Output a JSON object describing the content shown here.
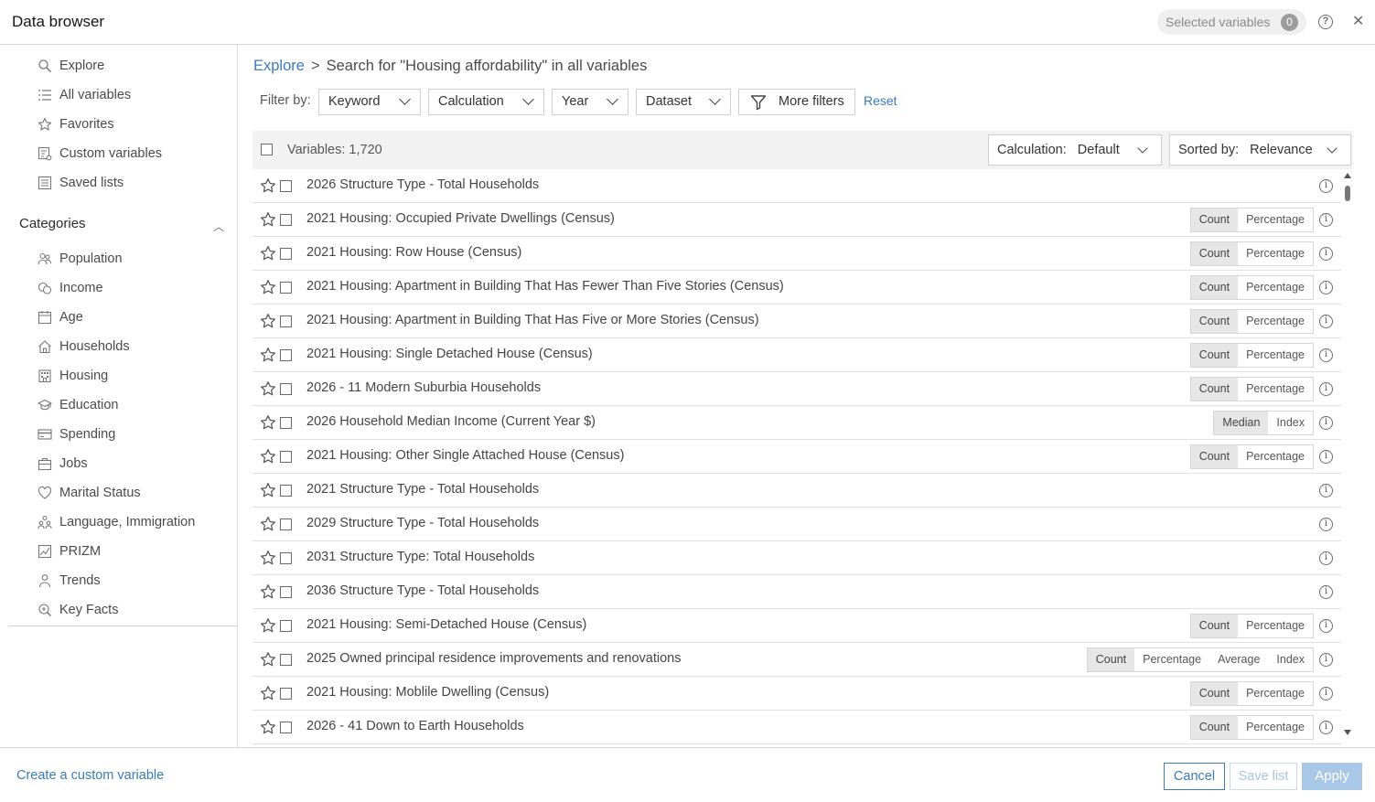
{
  "window": {
    "title": "Data browser",
    "selected_label": "Selected variables",
    "selected_count": "0"
  },
  "sidebar": {
    "nav": [
      {
        "label": "Explore",
        "icon": "search-icon"
      },
      {
        "label": "All variables",
        "icon": "list-icon"
      },
      {
        "label": "Favorites",
        "icon": "star-icon"
      },
      {
        "label": "Custom variables",
        "icon": "custom-variables-icon"
      },
      {
        "label": "Saved lists",
        "icon": "saved-lists-icon"
      }
    ],
    "categories_title": "Categories",
    "categories": [
      {
        "label": "Population",
        "icon": "population-icon"
      },
      {
        "label": "Income",
        "icon": "income-icon"
      },
      {
        "label": "Age",
        "icon": "calendar-icon"
      },
      {
        "label": "Households",
        "icon": "households-icon"
      },
      {
        "label": "Housing",
        "icon": "building-icon"
      },
      {
        "label": "Education",
        "icon": "education-icon"
      },
      {
        "label": "Spending",
        "icon": "credit-card-icon"
      },
      {
        "label": "Jobs",
        "icon": "briefcase-icon"
      },
      {
        "label": "Marital Status",
        "icon": "heart-icon"
      },
      {
        "label": "Language, Immigration",
        "icon": "language-icon"
      },
      {
        "label": "PRIZM",
        "icon": "prizm-icon"
      },
      {
        "label": "Trends",
        "icon": "person-icon"
      },
      {
        "label": "Key Facts",
        "icon": "key-facts-icon"
      }
    ]
  },
  "breadcrumb": {
    "root": "Explore",
    "sep": ">",
    "current": "Search for \"Housing affordability\" in all variables"
  },
  "filters": {
    "label": "Filter by:",
    "keyword": "Keyword",
    "calculation": "Calculation",
    "year": "Year",
    "dataset": "Dataset",
    "more": "More filters",
    "reset": "Reset"
  },
  "list": {
    "count_label": "Variables: 1,720",
    "calc_label": "Calculation:",
    "calc_value": "Default",
    "sort_label": "Sorted by:",
    "sort_value": "Relevance",
    "rows": [
      {
        "label": "2026 Structure Type - Total Households",
        "seg": []
      },
      {
        "label": "2021 Housing: Occupied Private Dwellings (Census)",
        "seg": [
          "Count",
          "Percentage"
        ]
      },
      {
        "label": "2021 Housing: Row House (Census)",
        "seg": [
          "Count",
          "Percentage"
        ]
      },
      {
        "label": "2021 Housing: Apartment in Building That Has Fewer Than Five Stories (Census)",
        "seg": [
          "Count",
          "Percentage"
        ]
      },
      {
        "label": "2021 Housing: Apartment in Building That Has Five or More Stories (Census)",
        "seg": [
          "Count",
          "Percentage"
        ]
      },
      {
        "label": "2021 Housing: Single Detached House (Census)",
        "seg": [
          "Count",
          "Percentage"
        ]
      },
      {
        "label": "2026 - 11 Modern Suburbia Households",
        "seg": [
          "Count",
          "Percentage"
        ]
      },
      {
        "label": "2026 Household Median Income (Current Year $)",
        "seg": [
          "Median",
          "Index"
        ]
      },
      {
        "label": "2021 Housing: Other Single Attached House (Census)",
        "seg": [
          "Count",
          "Percentage"
        ]
      },
      {
        "label": "2021 Structure Type - Total Households",
        "seg": []
      },
      {
        "label": "2029 Structure Type - Total Households",
        "seg": []
      },
      {
        "label": "2031 Structure Type: Total Households",
        "seg": []
      },
      {
        "label": "2036 Structure Type - Total Households",
        "seg": []
      },
      {
        "label": "2021 Housing: Semi-Detached House (Census)",
        "seg": [
          "Count",
          "Percentage"
        ]
      },
      {
        "label": "2025 Owned principal residence improvements and renovations",
        "seg": [
          "Count",
          "Percentage",
          "Average",
          "Index"
        ]
      },
      {
        "label": "2021 Housing: Moblile Dwelling (Census)",
        "seg": [
          "Count",
          "Percentage"
        ]
      },
      {
        "label": "2026 - 41 Down to Earth Households",
        "seg": [
          "Count",
          "Percentage"
        ]
      }
    ]
  },
  "footer": {
    "create": "Create a custom variable",
    "cancel": "Cancel",
    "save": "Save list",
    "apply": "Apply"
  },
  "colors": {
    "link": "#3a7ab8",
    "apply_disabled": "#a9c8e8"
  }
}
